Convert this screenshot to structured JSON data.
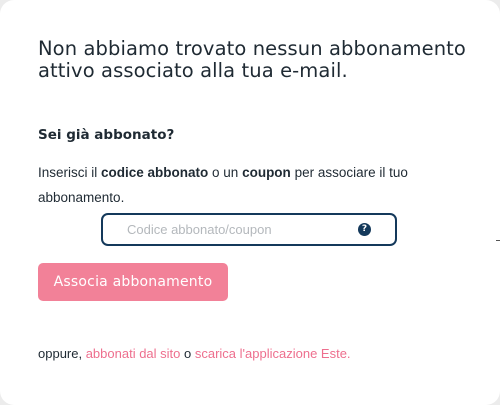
{
  "dialog": {
    "headline": "Non abbiamo trovato nessun abbonamento attivo associato alla tua e-mail.",
    "subheading": "Sei già abbonato?",
    "instructions": {
      "prefix": "Inserisci il ",
      "bold_code": "codice abbonato",
      "middle": " o un ",
      "bold_coupon": "coupon",
      "suffix": " per associare il tuo abbonamento."
    },
    "code_input": {
      "placeholder": "Codice abbonato/coupon",
      "value": "",
      "help_icon": "question-circle-icon",
      "help_glyph": "?"
    },
    "associate_button_label": "Associa abbonamento",
    "footer": {
      "prefix": "oppure, ",
      "site_link": "abbonati dal sito",
      "middle": " o ",
      "app_link": "scarica l'applicazione Este."
    }
  },
  "colors": {
    "accent_pink": "#f28198",
    "link_pink": "#ee6f8e",
    "navy": "#14395b",
    "text_dark": "#1f2a33"
  }
}
